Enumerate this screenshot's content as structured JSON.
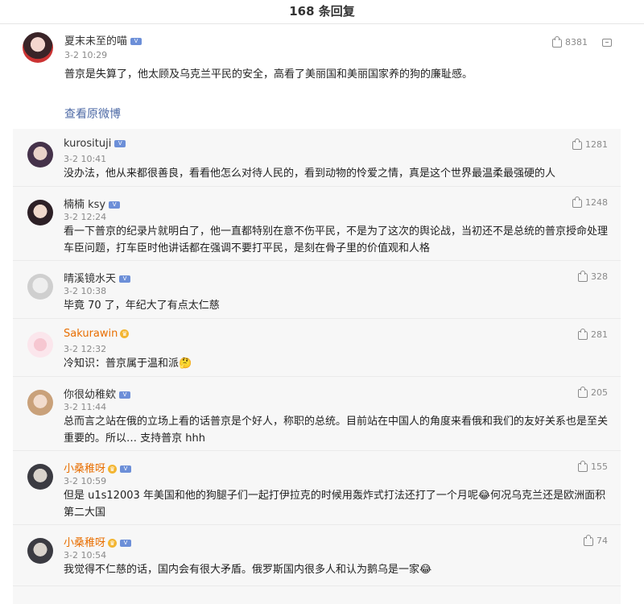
{
  "header": {
    "title": "168 条回复"
  },
  "main_comment": {
    "user": "夏末未至的喵",
    "time": "3-2 10:29",
    "text": "普京是失算了，他太顾及乌克兰平民的安全，高看了美丽国和美丽国家养的狗的廉耻感。",
    "likes": "8381",
    "view_original": "查看原微博"
  },
  "replies": [
    {
      "user": "kurosituji",
      "time": "3-2 10:41",
      "likes": "1281",
      "text": "没办法，他从来都很善良，看看他怎么对待人民的，看到动物的怜爱之情，真是这个世界最温柔最强硬的人"
    },
    {
      "user": "楠楠 ksy",
      "time": "3-2 12:24",
      "likes": "1248",
      "text": "看一下普京的纪录片就明白了，他一直都特别在意不伤平民，不是为了这次的舆论战，当初还不是总统的普京授命处理车臣问题，打车臣时他讲话都在强调不要打平民，是刻在骨子里的价值观和人格"
    },
    {
      "user": "晴溪镜水天",
      "time": "3-2 10:38",
      "likes": "328",
      "text": "毕竟 70 了，年纪大了有点太仁慈"
    },
    {
      "user": "Sakurawin",
      "time": "3-2 12:32",
      "likes": "281",
      "text": "冷知识：普京属于温和派🤔"
    },
    {
      "user": "你很幼稚欸",
      "time": "3-2 11:44",
      "likes": "205",
      "text": "总而言之站在俄的立场上看的话普京是个好人，称职的总统。目前站在中国人的角度来看俄和我们的友好关系也是至关重要的。所以… 支持普京 hhh"
    },
    {
      "user": "小桑稚呀",
      "time": "3-2 10:59",
      "likes": "155",
      "text": "但是 u1s12003 年美国和他的狗腿子们一起打伊拉克的时候用轰炸式打法还打了一个月呢😂何况乌克兰还是欧洲面积第二大国"
    },
    {
      "user": "小桑稚呀",
      "time": "3-2 10:54",
      "likes": "74",
      "text": "我觉得不仁慈的话，国内会有很大矛盾。俄罗斯国内很多人和认为鹅乌是一家😂"
    }
  ]
}
